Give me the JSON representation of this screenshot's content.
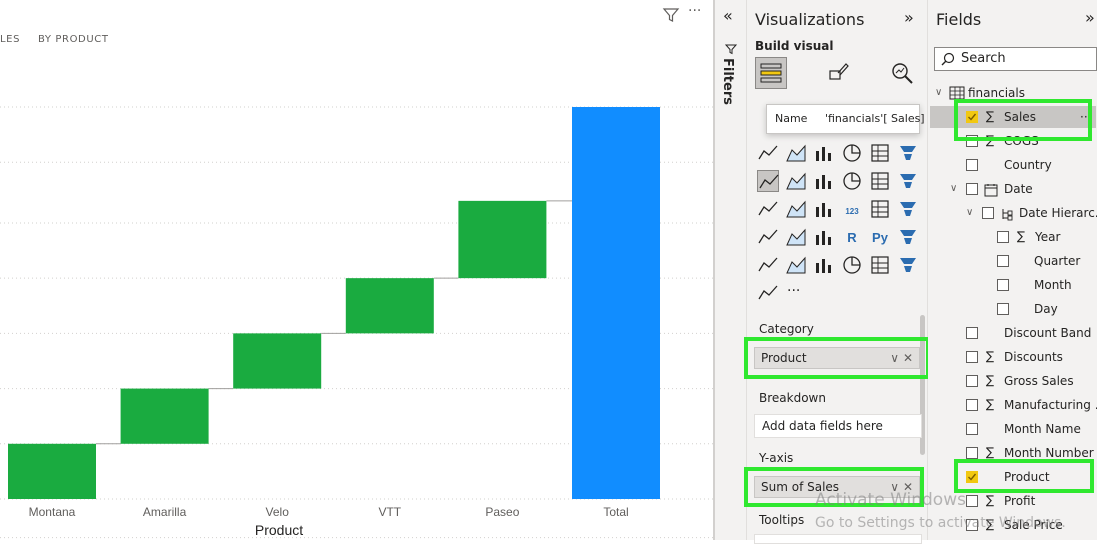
{
  "canvas": {
    "tabs": [
      "LES",
      "BY PRODUCT"
    ],
    "filter_icon": "filter-icon",
    "more_icon": "more-options-icon",
    "more_text": "···"
  },
  "chart_data": {
    "type": "bar",
    "subtype": "waterfall",
    "categories": [
      "Montana",
      "Amarilla",
      "Velo",
      "VTT",
      "Paseo",
      "Total"
    ],
    "steps": [
      {
        "category": "Montana",
        "start": 0,
        "end": 1
      },
      {
        "category": "Amarilla",
        "start": 1,
        "end": 2
      },
      {
        "category": "Velo",
        "start": 2,
        "end": 3
      },
      {
        "category": "VTT",
        "start": 3,
        "end": 4
      },
      {
        "category": "Paseo",
        "start": 4,
        "end": 5.4
      },
      {
        "category": "Total",
        "start": 0,
        "end": 7.1
      }
    ],
    "xlabel": "Product",
    "ylabel": "",
    "ylim": [
      -0.7,
      7.4
    ],
    "gridlines": [
      -0.7,
      0,
      1,
      2,
      3,
      4,
      5,
      6.1,
      7.1
    ],
    "grid": true,
    "colors": {
      "increase": "#1aab40",
      "total": "#118dff"
    }
  },
  "filters_strip": {
    "title": "Filters",
    "collapse_icon": "double-chevron-left-icon",
    "collapse_text": "«"
  },
  "visualizations": {
    "title": "Visualizations",
    "expand_icon": "double-chevron-right-icon",
    "expand_text": "»",
    "build_visual": "Build visual",
    "tooltip": {
      "name_label": "Name",
      "name_value": "'financials'[ Sales]"
    },
    "wells": {
      "category_label": "Category",
      "category_value": "Product",
      "breakdown_label": "Breakdown",
      "breakdown_placeholder": "Add data fields here",
      "yaxis_label": "Y-axis",
      "yaxis_value": "Sum of Sales",
      "tooltips_label": "Tooltips"
    },
    "more_visuals": "···",
    "pill_dropdown": "∨",
    "pill_remove": "✕"
  },
  "fields": {
    "title": "Fields",
    "expand_text": "»",
    "search_placeholder": "Search",
    "table_name": "financials",
    "items": [
      {
        "label": "Sales",
        "sigma": true,
        "checked": true
      },
      {
        "label": "COGS",
        "sigma": true,
        "checked": false
      },
      {
        "label": "Country",
        "sigma": false,
        "checked": false
      },
      {
        "label": "Date",
        "sigma": false,
        "checked": false
      },
      {
        "label": "Date Hierarc...",
        "sigma": false,
        "checked": false
      },
      {
        "label": "Year",
        "sigma": true,
        "checked": false
      },
      {
        "label": "Quarter",
        "sigma": false,
        "checked": false
      },
      {
        "label": "Month",
        "sigma": false,
        "checked": false
      },
      {
        "label": "Day",
        "sigma": false,
        "checked": false
      },
      {
        "label": "Discount Band",
        "sigma": false,
        "checked": false
      },
      {
        "label": "Discounts",
        "sigma": true,
        "checked": false
      },
      {
        "label": "Gross Sales",
        "sigma": true,
        "checked": false
      },
      {
        "label": "Manufacturing ...",
        "sigma": true,
        "checked": false
      },
      {
        "label": "Month Name",
        "sigma": false,
        "checked": false
      },
      {
        "label": "Month Number",
        "sigma": true,
        "checked": false
      },
      {
        "label": "Product",
        "sigma": false,
        "checked": true
      },
      {
        "label": "Profit",
        "sigma": true,
        "checked": false
      },
      {
        "label": "Sale Price",
        "sigma": true,
        "checked": false
      }
    ],
    "row_more": "···",
    "sigma_glyph": "∑"
  },
  "watermark": {
    "line1": "Activate Windows",
    "line2": "Go to Settings to activate Windows."
  },
  "highlight_color": "#2fe82f"
}
